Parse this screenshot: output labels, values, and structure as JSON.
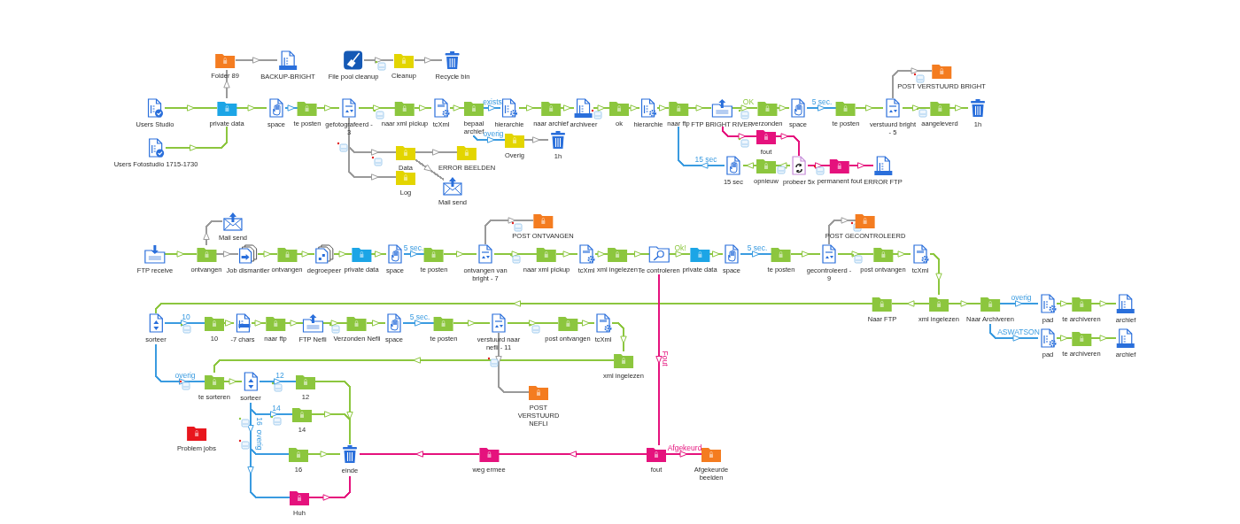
{
  "nodes": [
    {
      "label": "Folder 89",
      "kind": "folder",
      "color": "#f47c20"
    },
    {
      "label": "BACKUP-BRIGHT",
      "kind": "archive"
    },
    {
      "label": "File pool cleanup",
      "kind": "cleanup"
    },
    {
      "label": "Cleanup",
      "kind": "folder",
      "color": "#e3d500"
    },
    {
      "label": "Recycle bin",
      "kind": "trash"
    },
    {
      "label": "POST VERSTUURD BRIGHT",
      "kind": "folder",
      "color": "#f47c20"
    },
    {
      "label": "Users Studio",
      "kind": "users"
    },
    {
      "label": "private data",
      "kind": "folder",
      "color": "#1ca5e6"
    },
    {
      "label": "space",
      "kind": "hand"
    },
    {
      "label": "te posten",
      "kind": "folder",
      "color": "#8cc63e"
    },
    {
      "label": "gefotografeerd - 3",
      "kind": "http"
    },
    {
      "label": "naar xml pickup",
      "kind": "folder",
      "color": "#8cc63e"
    },
    {
      "label": "tcXml",
      "kind": "xml"
    },
    {
      "label": "bepaal archief",
      "kind": "folder",
      "color": "#8cc63e"
    },
    {
      "label": "hierarchie",
      "kind": "hierarchy"
    },
    {
      "label": "naar archief",
      "kind": "folder",
      "color": "#8cc63e"
    },
    {
      "label": "archiveer",
      "kind": "archive"
    },
    {
      "label": "ok",
      "kind": "folder",
      "color": "#8cc63e"
    },
    {
      "label": "hierarchie",
      "kind": "hierarchy"
    },
    {
      "label": "naar ftp",
      "kind": "folder",
      "color": "#8cc63e"
    },
    {
      "label": "FTP BRIGHT RIVER",
      "kind": "ftp-send"
    },
    {
      "label": "verzonden",
      "kind": "folder",
      "color": "#8cc63e"
    },
    {
      "label": "space",
      "kind": "hand"
    },
    {
      "label": "te posten",
      "kind": "folder",
      "color": "#8cc63e"
    },
    {
      "label": "verstuurd bright - 5",
      "kind": "http"
    },
    {
      "label": "aangeleverd",
      "kind": "folder",
      "color": "#8cc63e"
    },
    {
      "label": "1h",
      "kind": "trash"
    },
    {
      "label": "fout",
      "kind": "folder",
      "color": "#e5127d"
    },
    {
      "label": "Overig",
      "kind": "folder",
      "color": "#e3d500"
    },
    {
      "label": "1h",
      "kind": "trash"
    },
    {
      "label": "Users Fotostudio 1715-1730",
      "kind": "users"
    },
    {
      "label": "Data",
      "kind": "folder",
      "color": "#e3d500"
    },
    {
      "label": "ERROR BEELDEN",
      "kind": "folder",
      "color": "#e3d500"
    },
    {
      "label": "15 sec",
      "kind": "hand"
    },
    {
      "label": "opnieuw",
      "kind": "folder",
      "color": "#8cc63e"
    },
    {
      "label": "probeer 5x",
      "kind": "retry"
    },
    {
      "label": "permanent fout",
      "kind": "folder",
      "color": "#e5127d"
    },
    {
      "label": "ERROR FTP",
      "kind": "archive"
    },
    {
      "label": "Log",
      "kind": "folder",
      "color": "#e3d500"
    },
    {
      "label": "Mail send",
      "kind": "mail"
    },
    {
      "label": "Mail send",
      "kind": "mail"
    },
    {
      "label": "POST ONTVANGEN",
      "kind": "folder",
      "color": "#f47c20"
    },
    {
      "label": "POST GECONTROLEERD",
      "kind": "folder",
      "color": "#f47c20"
    },
    {
      "label": "FTP receive",
      "kind": "ftp-receive"
    },
    {
      "label": "ontvangen",
      "kind": "folder",
      "color": "#8cc63e"
    },
    {
      "label": "Job dismantler",
      "kind": "dismantle"
    },
    {
      "label": "ontvangen",
      "kind": "folder",
      "color": "#8cc63e"
    },
    {
      "label": "degroepeer",
      "kind": "group"
    },
    {
      "label": "private data",
      "kind": "folder",
      "color": "#1ca5e6"
    },
    {
      "label": "space",
      "kind": "hand"
    },
    {
      "label": "te posten",
      "kind": "folder",
      "color": "#8cc63e"
    },
    {
      "label": "ontvangen van bright - 7",
      "kind": "http"
    },
    {
      "label": "naar xml pickup",
      "kind": "folder",
      "color": "#8cc63e"
    },
    {
      "label": "tcXml",
      "kind": "xml"
    },
    {
      "label": "xml ingelezen",
      "kind": "folder",
      "color": "#8cc63e"
    },
    {
      "label": "Te controleren",
      "kind": "search"
    },
    {
      "label": "private data",
      "kind": "folder",
      "color": "#1ca5e6"
    },
    {
      "label": "space",
      "kind": "hand"
    },
    {
      "label": "te posten",
      "kind": "folder",
      "color": "#8cc63e"
    },
    {
      "label": "gecontroleerd - 9",
      "kind": "http"
    },
    {
      "label": "post ontvangen",
      "kind": "folder",
      "color": "#8cc63e"
    },
    {
      "label": "tcXml",
      "kind": "xml"
    },
    {
      "label": "Naar FTP",
      "kind": "folder",
      "color": "#8cc63e"
    },
    {
      "label": "xml ingelezen",
      "kind": "folder",
      "color": "#8cc63e"
    },
    {
      "label": "Naar Archiveren",
      "kind": "folder",
      "color": "#8cc63e"
    },
    {
      "label": "pad",
      "kind": "hierarchy"
    },
    {
      "label": "te archiveren",
      "kind": "folder",
      "color": "#8cc63e"
    },
    {
      "label": "archief",
      "kind": "archive"
    },
    {
      "label": "sorteer",
      "kind": "sort"
    },
    {
      "label": "10",
      "kind": "folder",
      "color": "#8cc63e"
    },
    {
      "label": "-7 chars",
      "kind": "chars"
    },
    {
      "label": "naar ftp",
      "kind": "folder",
      "color": "#8cc63e"
    },
    {
      "label": "FTP Nefli",
      "kind": "ftp-send"
    },
    {
      "label": "Verzonden Nefli",
      "kind": "folder",
      "color": "#8cc63e"
    },
    {
      "label": "space",
      "kind": "hand"
    },
    {
      "label": "te posten",
      "kind": "folder",
      "color": "#8cc63e"
    },
    {
      "label": "verstuurd naar nefli - 11",
      "kind": "http"
    },
    {
      "label": "post ontvangen",
      "kind": "folder",
      "color": "#8cc63e"
    },
    {
      "label": "tcXml",
      "kind": "xml"
    },
    {
      "label": "pad",
      "kind": "hierarchy"
    },
    {
      "label": "te archiveren",
      "kind": "folder",
      "color": "#8cc63e"
    },
    {
      "label": "archief",
      "kind": "archive"
    },
    {
      "label": "xml ingelezen",
      "kind": "folder",
      "color": "#8cc63e"
    },
    {
      "label": "te sorteren",
      "kind": "folder",
      "color": "#8cc63e"
    },
    {
      "label": "sorteer",
      "kind": "sort"
    },
    {
      "label": "12",
      "kind": "folder",
      "color": "#8cc63e"
    },
    {
      "label": "POST VERSTUURD NEFLI",
      "kind": "folder",
      "color": "#f47c20"
    },
    {
      "label": "14",
      "kind": "folder",
      "color": "#8cc63e"
    },
    {
      "label": "Problem jobs",
      "kind": "folder",
      "color": "#e8161d"
    },
    {
      "label": "16",
      "kind": "folder",
      "color": "#8cc63e"
    },
    {
      "label": "einde",
      "kind": "trash"
    },
    {
      "label": "weg ermee",
      "kind": "folder",
      "color": "#e5127d"
    },
    {
      "label": "fout",
      "kind": "folder",
      "color": "#e5127d"
    },
    {
      "label": "Afgekeurde beelden",
      "kind": "folder",
      "color": "#f47c20"
    },
    {
      "label": "Huh",
      "kind": "folder",
      "color": "#e5127d"
    }
  ],
  "connections": [
    {
      "color": "#8cc63e"
    },
    {
      "color": "#8cc63e"
    },
    {
      "color": "#9a9a9a"
    },
    {
      "color": "#9a9a9a"
    },
    {
      "color": "#9a9a9a"
    },
    {
      "color": "#9a9a9a"
    },
    {
      "color": "#8cc63e"
    },
    {
      "color": "#3a9be0"
    },
    {
      "color": "#8cc63e"
    },
    {
      "color": "#8cc63e"
    },
    {
      "color": "#8cc63e"
    },
    {
      "color": "#8cc63e"
    },
    {
      "color": "#3a9be0",
      "label": "exists"
    },
    {
      "color": "#3a9be0",
      "label": "overig"
    },
    {
      "color": "#9a9a9a"
    },
    {
      "color": "#8cc63e"
    },
    {
      "color": "#8cc63e"
    },
    {
      "color": "#8cc63e"
    },
    {
      "color": "#8cc63e"
    },
    {
      "color": "#8cc63e"
    },
    {
      "color": "#8cc63e"
    },
    {
      "color": "#8cc63e",
      "label": "OK"
    },
    {
      "color": "#8cc63e"
    },
    {
      "color": "#3a9be0",
      "label": "5 sec."
    },
    {
      "color": "#8cc63e"
    },
    {
      "color": "#8cc63e"
    },
    {
      "color": "#8cc63e"
    },
    {
      "color": "#9a9a9a"
    },
    {
      "color": "#e5127d"
    },
    {
      "color": "#e5127d"
    },
    {
      "color": "#8cc63e"
    },
    {
      "color": "#8cc63e"
    },
    {
      "color": "#3a9be0",
      "label": "15 sec"
    },
    {
      "color": "#e5127d"
    },
    {
      "color": "#e5127d"
    },
    {
      "color": "#9a9a9a"
    },
    {
      "color": "#9a9a9a"
    },
    {
      "color": "#9a9a9a"
    },
    {
      "color": "#9a9a9a"
    },
    {
      "color": "#8cc63e"
    },
    {
      "color": "#9a9a9a"
    },
    {
      "color": "#9a9a9a"
    },
    {
      "color": "#8cc63e"
    },
    {
      "color": "#8cc63e"
    },
    {
      "color": "#8cc63e"
    },
    {
      "color": "#8cc63e"
    },
    {
      "color": "#3a9be0",
      "label": "5 sec."
    },
    {
      "color": "#8cc63e"
    },
    {
      "color": "#9a9a9a"
    },
    {
      "color": "#8cc63e"
    },
    {
      "color": "#8cc63e"
    },
    {
      "color": "#8cc63e"
    },
    {
      "color": "#8cc63e"
    },
    {
      "color": "#8cc63e",
      "label": "Ok!"
    },
    {
      "color": "#8cc63e"
    },
    {
      "color": "#3a9be0",
      "label": "5 sec."
    },
    {
      "color": "#8cc63e"
    },
    {
      "color": "#9a9a9a"
    },
    {
      "color": "#8cc63e"
    },
    {
      "color": "#8cc63e"
    },
    {
      "color": "#8cc63e"
    },
    {
      "color": "#8cc63e"
    },
    {
      "color": "#8cc63e"
    },
    {
      "color": "#3a9be0",
      "label": "overig"
    },
    {
      "color": "#3a9be0",
      "label": "ASWATSON"
    },
    {
      "color": "#8cc63e"
    },
    {
      "color": "#8cc63e"
    },
    {
      "color": "#8cc63e"
    },
    {
      "color": "#8cc63e"
    },
    {
      "color": "#8cc63e"
    },
    {
      "color": "#3a9be0",
      "label": "10"
    },
    {
      "color": "#8cc63e"
    },
    {
      "color": "#8cc63e"
    },
    {
      "color": "#8cc63e"
    },
    {
      "color": "#8cc63e"
    },
    {
      "color": "#8cc63e"
    },
    {
      "color": "#3a9be0",
      "label": "5 sec."
    },
    {
      "color": "#8cc63e"
    },
    {
      "color": "#8cc63e"
    },
    {
      "color": "#8cc63e"
    },
    {
      "color": "#8cc63e"
    },
    {
      "color": "#8cc63e"
    },
    {
      "color": "#9a9a9a"
    },
    {
      "color": "#3a9be0",
      "label": "overig"
    },
    {
      "color": "#8cc63e"
    },
    {
      "color": "#3a9be0",
      "label": "12"
    },
    {
      "color": "#3a9be0",
      "label": "14"
    },
    {
      "color": "#3a9be0",
      "label": "16"
    },
    {
      "color": "#3a9be0",
      "label": "overig"
    },
    {
      "color": "#8cc63e"
    },
    {
      "color": "#8cc63e"
    },
    {
      "color": "#8cc63e"
    },
    {
      "color": "#e5127d"
    },
    {
      "color": "#e5127d"
    },
    {
      "color": "#e5127d"
    },
    {
      "color": "#e5127d",
      "label": "Fout"
    },
    {
      "color": "#e5127d",
      "label": "Afgekeurd"
    }
  ]
}
